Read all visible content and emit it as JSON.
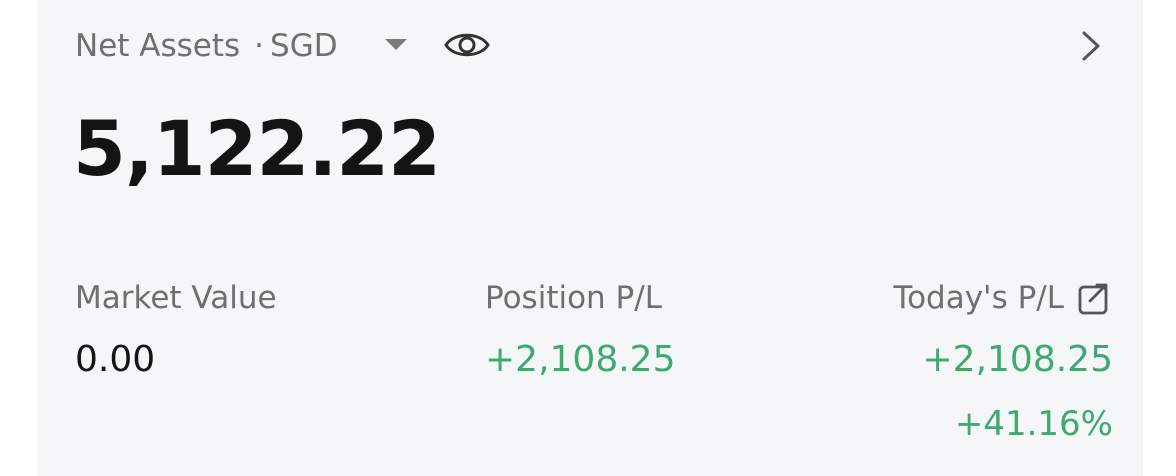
{
  "header": {
    "title": "Net Assets",
    "separator": "·",
    "currency": "SGD",
    "icons": [
      "caret-down-icon",
      "eye-icon",
      "chevron-right-icon"
    ]
  },
  "net_assets": {
    "value": "5,122.22"
  },
  "metrics": {
    "market_value": {
      "label": "Market Value",
      "value": "0.00"
    },
    "position_pl": {
      "label": "Position P/L",
      "value": "+2,108.25"
    },
    "todays_pl": {
      "label": "Today's P/L",
      "value": "+2,108.25",
      "percent": "+41.16%",
      "icon": "share-icon"
    }
  },
  "colors": {
    "card_bg": "#f5f6f8",
    "label": "#6f6f6f",
    "primary_text": "#141414",
    "positive": "#3faa6e"
  }
}
